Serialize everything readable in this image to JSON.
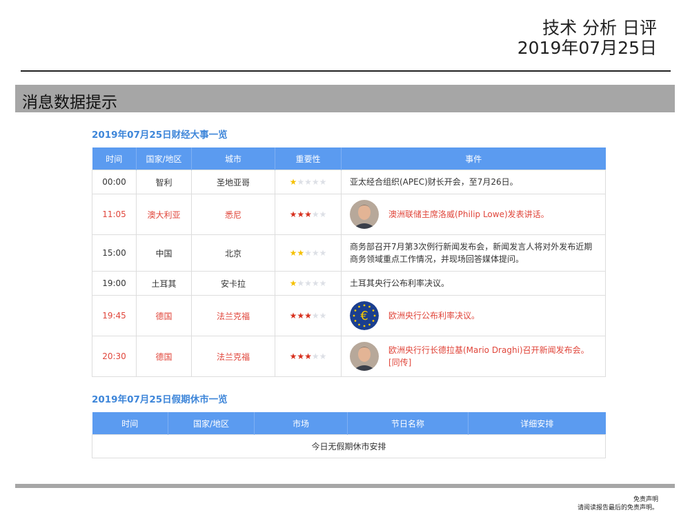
{
  "header": {
    "title_line1": "技术 分析 日评",
    "title_line2": "2019年07月25日"
  },
  "band_title": "消息数据提示",
  "events_section": {
    "title": "2019年07月25日财经大事一览",
    "columns": [
      "时间",
      "国家/地区",
      "城市",
      "重要性",
      "事件"
    ],
    "rows": [
      {
        "time": "00:00",
        "country": "智利",
        "city": "圣地亚哥",
        "importance": 1,
        "highlight": false,
        "avatar": "",
        "event": "亚太经合组织(APEC)财长开会，至7月26日。",
        "event2": ""
      },
      {
        "time": "11:05",
        "country": "澳大利亚",
        "city": "悉尼",
        "importance": 3,
        "highlight": true,
        "avatar": "person-photo",
        "event": "澳洲联储主席洛威(Philip Lowe)发表讲话。",
        "event2": ""
      },
      {
        "time": "15:00",
        "country": "中国",
        "city": "北京",
        "importance": 2,
        "highlight": false,
        "avatar": "",
        "event": "商务部召开7月第3次例行新闻发布会，新闻发言人将对外发布近期",
        "event2": "商务领域重点工作情况，并现场回答媒体提问。"
      },
      {
        "time": "19:00",
        "country": "土耳其",
        "city": "安卡拉",
        "importance": 1,
        "highlight": false,
        "avatar": "",
        "event": "土耳其央行公布利率决议。",
        "event2": ""
      },
      {
        "time": "19:45",
        "country": "德国",
        "city": "法兰克福",
        "importance": 3,
        "highlight": true,
        "avatar": "euro-icon",
        "event": "欧洲央行公布利率决议。",
        "event2": ""
      },
      {
        "time": "20:30",
        "country": "德国",
        "city": "法兰克福",
        "importance": 3,
        "highlight": true,
        "avatar": "person-photo",
        "event": "欧洲央行行长德拉基(Mario Draghi)召开新闻发布会。",
        "event2": "[同传]"
      }
    ]
  },
  "holiday_section": {
    "title": "2019年07月25日假期休市一览",
    "columns": [
      "时间",
      "国家/地区",
      "市场",
      "节日名称",
      "详细安排"
    ],
    "empty_text": "今日无假期休市安排"
  },
  "footer": {
    "line1": "免责声明",
    "line2": "请阅读报告最后的免责声明。"
  },
  "colors": {
    "header_blue": "#5b9bf0",
    "highlight_red": "#e0453a",
    "section_title_blue": "#3e86d9",
    "band_gray": "#a6a6a6"
  }
}
